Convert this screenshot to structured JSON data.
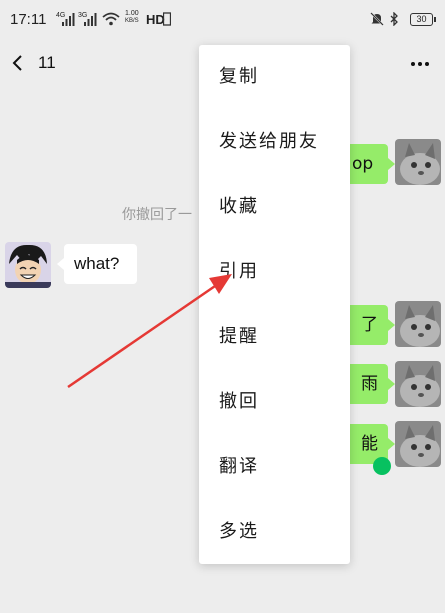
{
  "status_bar": {
    "time": "17:11",
    "sig1": "4G",
    "sig2": "3G",
    "speed_top": "1.00",
    "speed_bottom": "KB/S",
    "hd": "HD",
    "battery": "30"
  },
  "header": {
    "title": "11"
  },
  "messages": {
    "right_1_text": "op",
    "recall_notice": "你撤回了一",
    "left_1_text": "what?",
    "right_2_text": "了",
    "right_3_text": "雨",
    "right_4_text": "能"
  },
  "context_menu": {
    "items": [
      {
        "label": "复制"
      },
      {
        "label": "发送给朋友"
      },
      {
        "label": "收藏"
      },
      {
        "label": "引用"
      },
      {
        "label": "提醒"
      },
      {
        "label": "撤回"
      },
      {
        "label": "翻译"
      },
      {
        "label": "多选"
      }
    ]
  },
  "colors": {
    "background": "#ededed",
    "bubble_green": "#95ec69",
    "annotation_arrow": "#e53935",
    "online_dot": "#07c160"
  },
  "icons": [
    "back-arrow-icon",
    "more-icon",
    "wifi-icon",
    "mute-icon",
    "bluetooth-icon",
    "battery-icon"
  ]
}
